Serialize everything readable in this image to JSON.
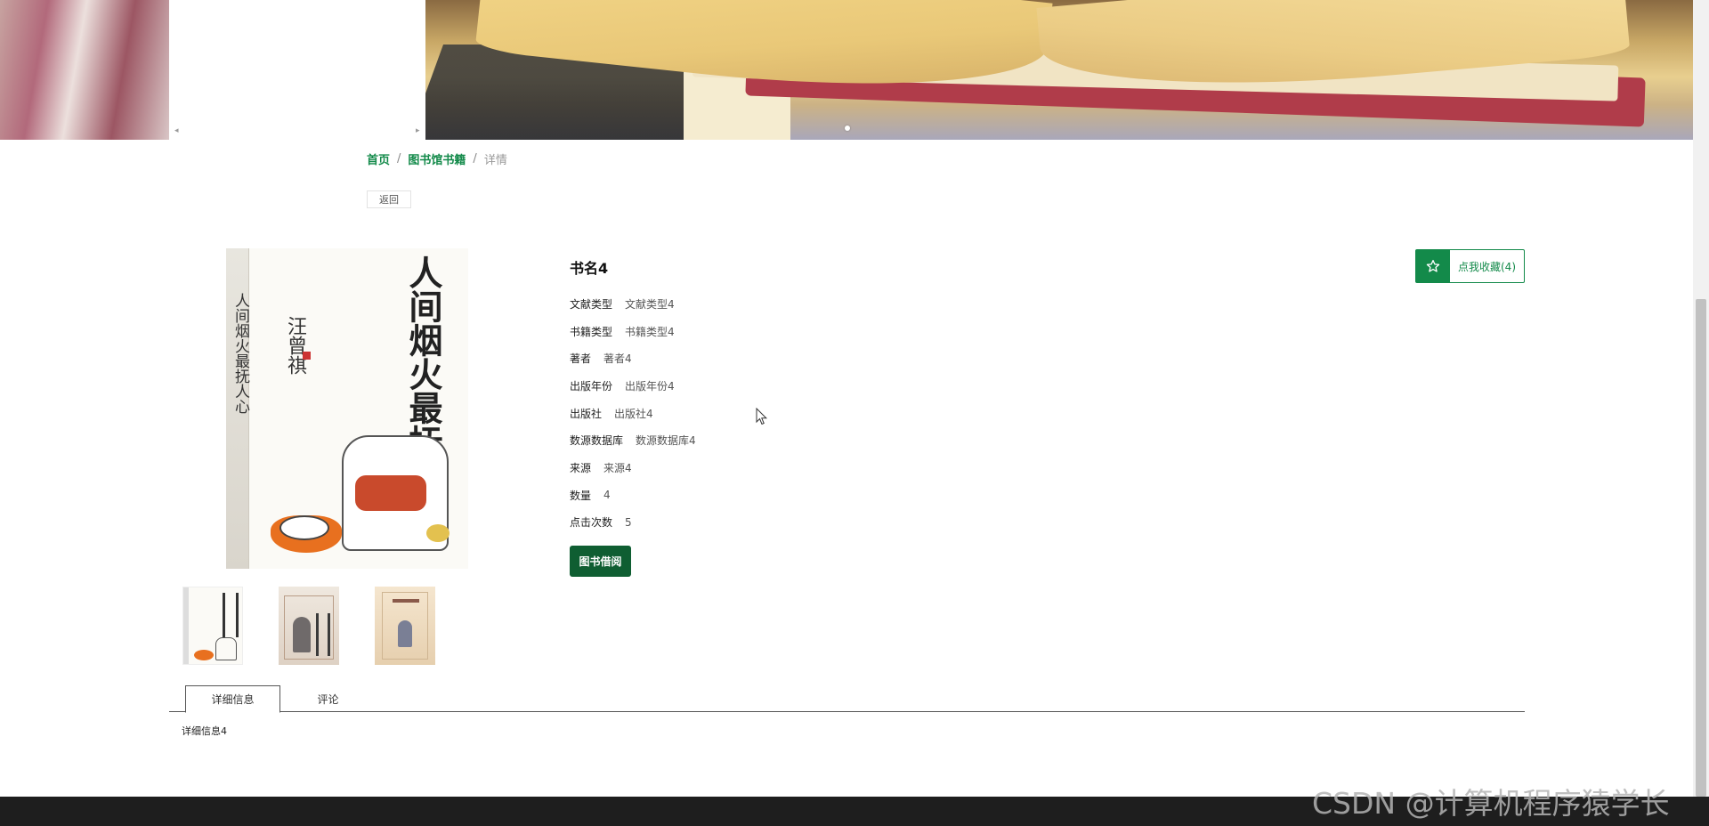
{
  "breadcrumb": {
    "home": "首页",
    "separator": "/",
    "library": "图书馆书籍",
    "current": "详情"
  },
  "back_label": "返回",
  "cover": {
    "title": "人间烟火最抚人心",
    "author": "汪曾祺",
    "spine_title": "人间烟火最抚人心",
    "spine_author": "汪曾祺"
  },
  "book": {
    "title": "书名4",
    "fields": [
      {
        "label": "文献类型",
        "value": "文献类型4"
      },
      {
        "label": "书籍类型",
        "value": "书籍类型4"
      },
      {
        "label": "著者",
        "value": "著者4"
      },
      {
        "label": "出版年份",
        "value": "出版年份4"
      },
      {
        "label": "出版社",
        "value": "出版社4"
      },
      {
        "label": "数源数据库",
        "value": "数源数据库4"
      },
      {
        "label": "来源",
        "value": "来源4"
      },
      {
        "label": "数量",
        "value": "4"
      },
      {
        "label": "点击次数",
        "value": "5"
      }
    ],
    "borrow_label": "图书借阅"
  },
  "favorite": {
    "label": "点我收藏(4)",
    "icon": "star-outline-icon"
  },
  "tabs": {
    "details_label": "详细信息",
    "comments_label": "评论"
  },
  "tab_content": "详细信息4",
  "watermark": "CSDN @计算机程序猿学长",
  "colors": {
    "accent": "#138a4a",
    "borrow_button": "#0f5e32",
    "footer": "#1e1e1e"
  },
  "carousel": {
    "prev_arrow": "◂",
    "next_arrow": "▸"
  }
}
